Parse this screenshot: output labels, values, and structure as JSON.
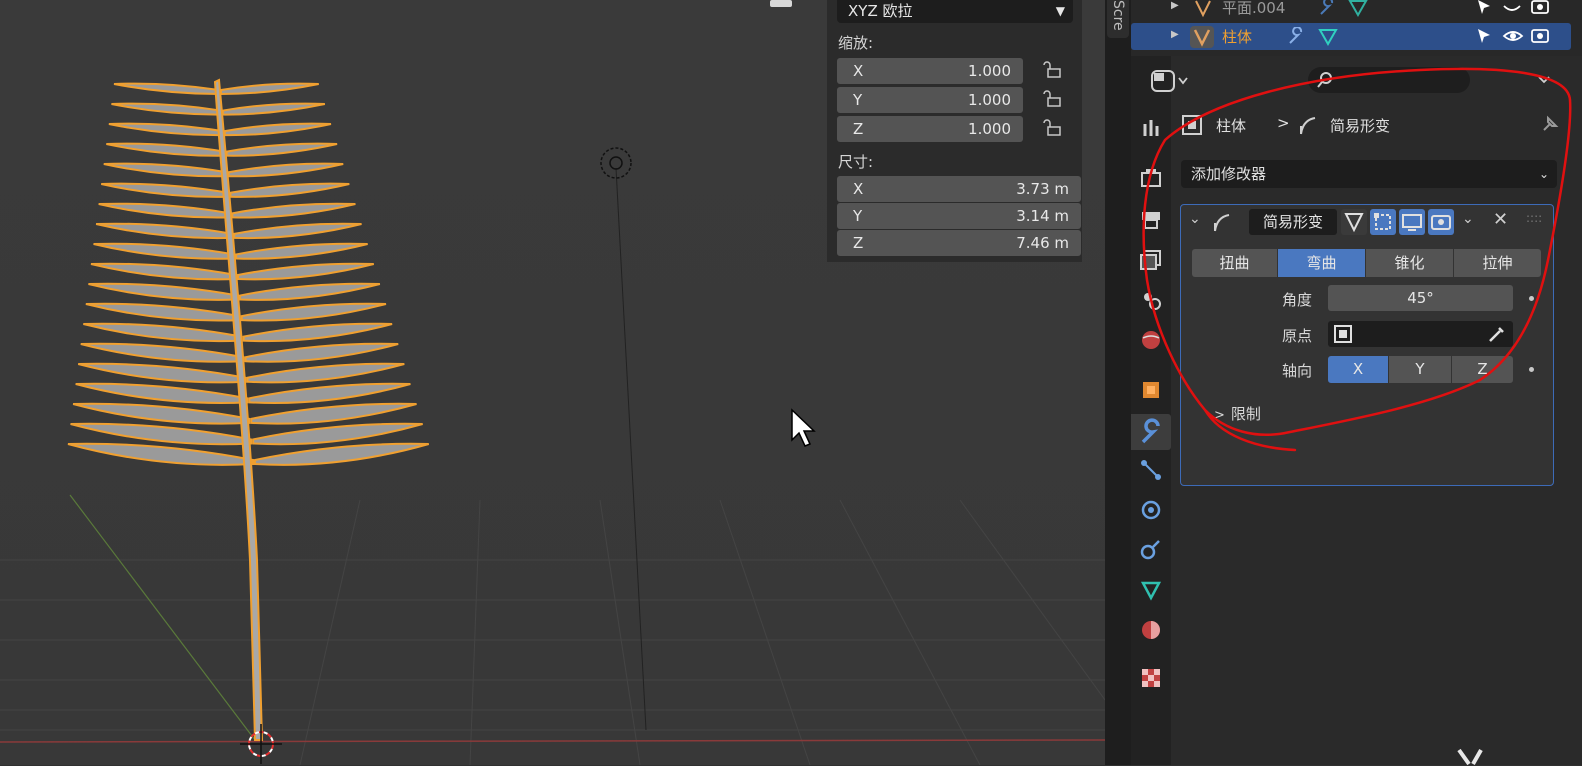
{
  "npanel": {
    "rotation_mode": "XYZ 欧拉",
    "scale_label": "缩放:",
    "scale": [
      {
        "axis": "X",
        "value": "1.000"
      },
      {
        "axis": "Y",
        "value": "1.000"
      },
      {
        "axis": "Z",
        "value": "1.000"
      }
    ],
    "dimensions_label": "尺寸:",
    "dimensions": [
      {
        "axis": "X",
        "value": "3.73 m"
      },
      {
        "axis": "Y",
        "value": "3.14 m"
      },
      {
        "axis": "Z",
        "value": "7.46 m"
      }
    ]
  },
  "sidebar_tab": "Scre",
  "outliner": {
    "rows": [
      {
        "name": "平面.004",
        "selected": false
      },
      {
        "name": "柱体",
        "selected": true
      }
    ]
  },
  "properties": {
    "breadcrumb_object": "柱体",
    "breadcrumb_modifier": "简易形变",
    "add_modifier": "添加修改器",
    "modifier": {
      "name": "简易形变",
      "modes": [
        "扭曲",
        "弯曲",
        "锥化",
        "拉伸"
      ],
      "active_mode": 1,
      "angle_label": "角度",
      "angle_value": "45°",
      "origin_label": "原点",
      "axis_label": "轴向",
      "axes": [
        "X",
        "Y",
        "Z"
      ],
      "active_axis": 0,
      "limits_label": "限制"
    }
  },
  "colors": {
    "selection_orange": "#f0a030",
    "active_blue": "#4a78c0",
    "annotation_red": "#e01010"
  }
}
